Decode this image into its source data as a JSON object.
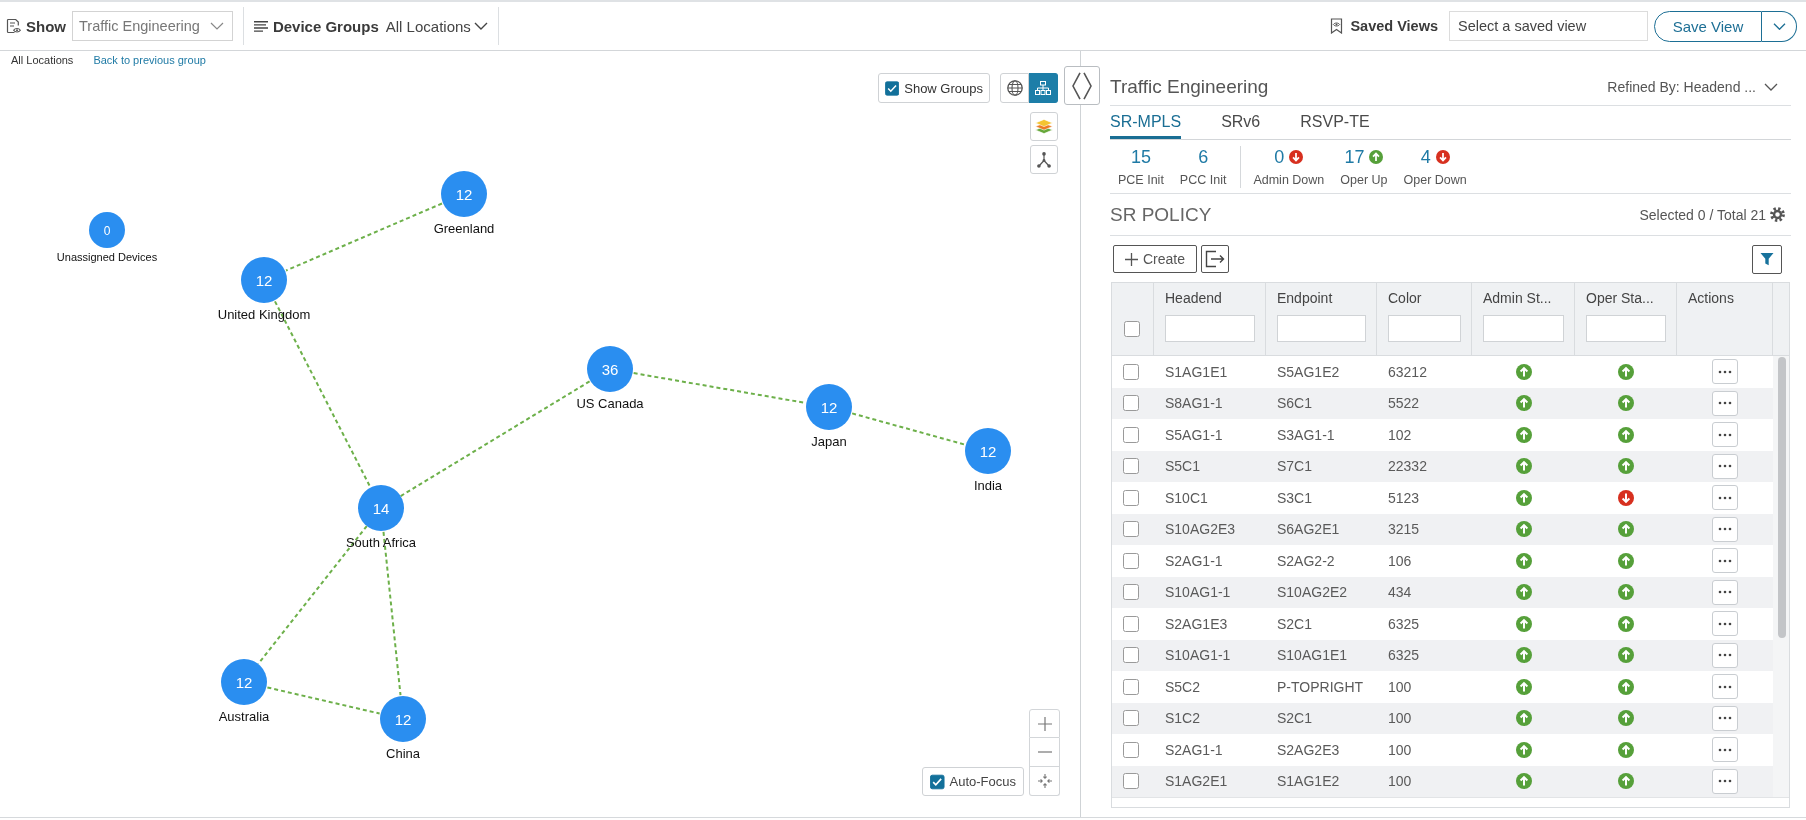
{
  "toolbar": {
    "show_label": "Show",
    "show_value": "Traffic Engineering",
    "device_groups_label": "Device Groups",
    "device_groups_value": "All Locations",
    "saved_views_label": "Saved Views",
    "saved_views_placeholder": "Select a saved view",
    "save_button": "Save View"
  },
  "breadcrumb": {
    "current": "All Locations",
    "back_link": "Back to previous group"
  },
  "map": {
    "show_groups": {
      "label": "Show Groups",
      "checked": true
    },
    "view_modes": [
      {
        "kind": "globe",
        "selected": false
      },
      {
        "kind": "topology",
        "selected": true
      }
    ],
    "nodes": [
      {
        "kind": "unassigned",
        "count": "0",
        "label": "Unassigned Devices"
      },
      {
        "kind": "group",
        "count": "12",
        "label": "Greenland"
      },
      {
        "kind": "group",
        "count": "12",
        "label": "United Kingdom"
      },
      {
        "kind": "group",
        "count": "36",
        "label": "US Canada"
      },
      {
        "kind": "group",
        "count": "12",
        "label": "Japan"
      },
      {
        "kind": "group",
        "count": "12",
        "label": "India"
      },
      {
        "kind": "group",
        "count": "14",
        "label": "South Africa"
      },
      {
        "kind": "group",
        "count": "12",
        "label": "Australia"
      },
      {
        "kind": "group",
        "count": "12",
        "label": "China"
      }
    ],
    "auto_focus": {
      "label": "Auto-Focus",
      "checked": true
    }
  },
  "panel": {
    "title": "Traffic Engineering",
    "refined_by": "Refined By: Headend ...",
    "tabs": [
      {
        "label": "SR-MPLS",
        "selected": true
      },
      {
        "label": "SRv6",
        "selected": false
      },
      {
        "label": "RSVP-TE",
        "selected": false
      }
    ],
    "stat_groups": [
      {
        "items": [
          {
            "value": "15",
            "label": "PCE Init"
          },
          {
            "value": "6",
            "label": "PCC Init"
          }
        ]
      },
      {
        "items": [
          {
            "value": "0",
            "label": "Admin Down",
            "up": false
          },
          {
            "value": "17",
            "label": "Oper Up",
            "up": true
          },
          {
            "value": "4",
            "label": "Oper Down",
            "up": false
          }
        ]
      }
    ],
    "section_title": "SR POLICY",
    "selection_summary": "Selected 0 / Total 21",
    "create_button": "Create",
    "table": {
      "all_selected": false,
      "columns": [
        {
          "label": "Headend",
          "filterable": true
        },
        {
          "label": "Endpoint",
          "filterable": true
        },
        {
          "label": "Color",
          "filterable": true
        },
        {
          "label": "Admin St...",
          "filterable": true
        },
        {
          "label": "Oper Sta...",
          "filterable": true
        },
        {
          "label": "Actions",
          "filterable": false
        }
      ],
      "rows": [
        {
          "selected": false,
          "cells": [
            "S1AG1E1",
            "S5AG1E2",
            "63212"
          ],
          "admin_up": true,
          "oper_up": true
        },
        {
          "selected": false,
          "cells": [
            "S8AG1-1",
            "S6C1",
            "5522"
          ],
          "admin_up": true,
          "oper_up": true
        },
        {
          "selected": false,
          "cells": [
            "S5AG1-1",
            "S3AG1-1",
            "102"
          ],
          "admin_up": true,
          "oper_up": true
        },
        {
          "selected": false,
          "cells": [
            "S5C1",
            "S7C1",
            "22332"
          ],
          "admin_up": true,
          "oper_up": true
        },
        {
          "selected": false,
          "cells": [
            "S10C1",
            "S3C1",
            "5123"
          ],
          "admin_up": true,
          "oper_up": false
        },
        {
          "selected": false,
          "cells": [
            "S10AG2E3",
            "S6AG2E1",
            "3215"
          ],
          "admin_up": true,
          "oper_up": true
        },
        {
          "selected": false,
          "cells": [
            "S2AG1-1",
            "S2AG2-2",
            "106"
          ],
          "admin_up": true,
          "oper_up": true
        },
        {
          "selected": false,
          "cells": [
            "S10AG1-1",
            "S10AG2E2",
            "434"
          ],
          "admin_up": true,
          "oper_up": true
        },
        {
          "selected": false,
          "cells": [
            "S2AG1E3",
            "S2C1",
            "6325"
          ],
          "admin_up": true,
          "oper_up": true
        },
        {
          "selected": false,
          "cells": [
            "S10AG1-1",
            "S10AG1E1",
            "6325"
          ],
          "admin_up": true,
          "oper_up": true
        },
        {
          "selected": false,
          "cells": [
            "S5C2",
            "P-TOPRIGHT",
            "100"
          ],
          "admin_up": true,
          "oper_up": true
        },
        {
          "selected": false,
          "cells": [
            "S1C2",
            "S2C1",
            "100"
          ],
          "admin_up": true,
          "oper_up": true
        },
        {
          "selected": false,
          "cells": [
            "S2AG1-1",
            "S2AG2E3",
            "100"
          ],
          "admin_up": true,
          "oper_up": true
        },
        {
          "selected": false,
          "cells": [
            "S1AG2E1",
            "S1AG1E2",
            "100"
          ],
          "admin_up": true,
          "oper_up": true
        }
      ]
    }
  }
}
